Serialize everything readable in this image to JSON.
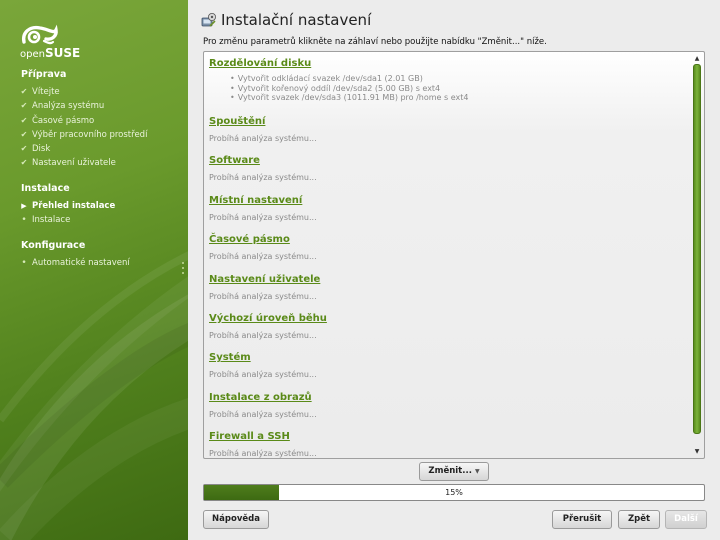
{
  "brand": {
    "logo_prefix": "open",
    "logo_name": "SUSE"
  },
  "sidebar": {
    "sections": [
      {
        "title": "Příprava",
        "steps": [
          {
            "label": "Vítejte",
            "state": "done"
          },
          {
            "label": "Analýza systému",
            "state": "done"
          },
          {
            "label": "Časové pásmo",
            "state": "done"
          },
          {
            "label": "Výběr pracovního prostředí",
            "state": "done"
          },
          {
            "label": "Disk",
            "state": "done"
          },
          {
            "label": "Nastavení uživatele",
            "state": "done"
          }
        ]
      },
      {
        "title": "Instalace",
        "steps": [
          {
            "label": "Přehled instalace",
            "state": "current"
          },
          {
            "label": "Instalace",
            "state": "pending"
          }
        ]
      },
      {
        "title": "Konfigurace",
        "steps": [
          {
            "label": "Automatické nastavení",
            "state": "pending"
          }
        ]
      }
    ]
  },
  "page": {
    "title": "Instalační nastavení",
    "help_text": "Pro změnu parametrů klikněte na záhlaví nebo použijte nabídku \"Změnit...\" níže."
  },
  "summary": {
    "sections": [
      {
        "title": "Rozdělování disku",
        "items": [
          "Vytvořit odkládací svazek /dev/sda1 (2.01 GB)",
          "Vytvořit kořenový oddíl /dev/sda2 (5.00 GB) s ext4",
          "Vytvořit svazek /dev/sda3 (1011.91 MB) pro /home s ext4"
        ]
      },
      {
        "title": "Spouštění",
        "status": "Probíhá analýza systému..."
      },
      {
        "title": "Software",
        "status": "Probíhá analýza systému..."
      },
      {
        "title": "Místní nastavení",
        "status": "Probíhá analýza systému..."
      },
      {
        "title": "Časové pásmo",
        "status": "Probíhá analýza systému..."
      },
      {
        "title": "Nastavení uživatele",
        "status": "Probíhá analýza systému..."
      },
      {
        "title": "Výchozí úroveň běhu",
        "status": "Probíhá analýza systému..."
      },
      {
        "title": "Systém",
        "status": "Probíhá analýza systému..."
      },
      {
        "title": "Instalace z obrazů",
        "status": "Probíhá analýza systému..."
      },
      {
        "title": "Firewall a SSH",
        "status": "Probíhá analýza systému..."
      }
    ]
  },
  "scroll_position": 0,
  "buttons": {
    "change": "Změnit...",
    "help": "Nápověda",
    "abort": "Přerušit",
    "back": "Zpět",
    "next": "Další"
  },
  "progress": {
    "value": 0.15,
    "label": "15%"
  },
  "colors": {
    "accent": "#5a8a18",
    "sidebar": "#6a9a2c",
    "progress": "#456f16"
  },
  "icons": {
    "check": "check-icon",
    "current": "play-arrow-icon",
    "pending": "bullet-icon",
    "title": "installer-icon"
  }
}
